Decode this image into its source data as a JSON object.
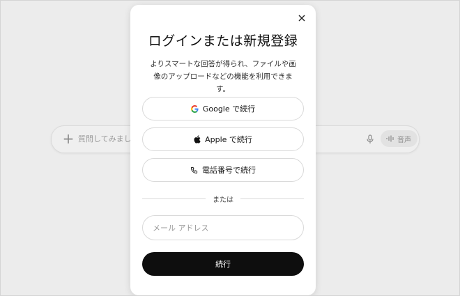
{
  "background": {
    "chat_placeholder": "質問してみましょう",
    "voice_label": "音声"
  },
  "modal": {
    "title": "ログインまたは新規登録",
    "subtitle": "よりスマートな回答が得られ、ファイルや画像のアップロードなどの機能を利用できます。",
    "buttons": {
      "google": "Google で続行",
      "apple": "Apple で続行",
      "phone": "電話番号で続行"
    },
    "divider": "または",
    "email": {
      "placeholder": "メール アドレス",
      "value": ""
    },
    "continue": "続行"
  },
  "colors": {
    "primary_button": "#0e0e0e",
    "google_blue": "#4285F4",
    "google_red": "#EA4335",
    "google_yellow": "#FBBC05",
    "google_green": "#34A853"
  },
  "icons": {
    "close": "close-icon",
    "plus": "plus-icon",
    "mic": "mic-icon",
    "voice": "waveform-icon",
    "google": "google-icon",
    "apple": "apple-icon",
    "phone": "phone-icon"
  }
}
